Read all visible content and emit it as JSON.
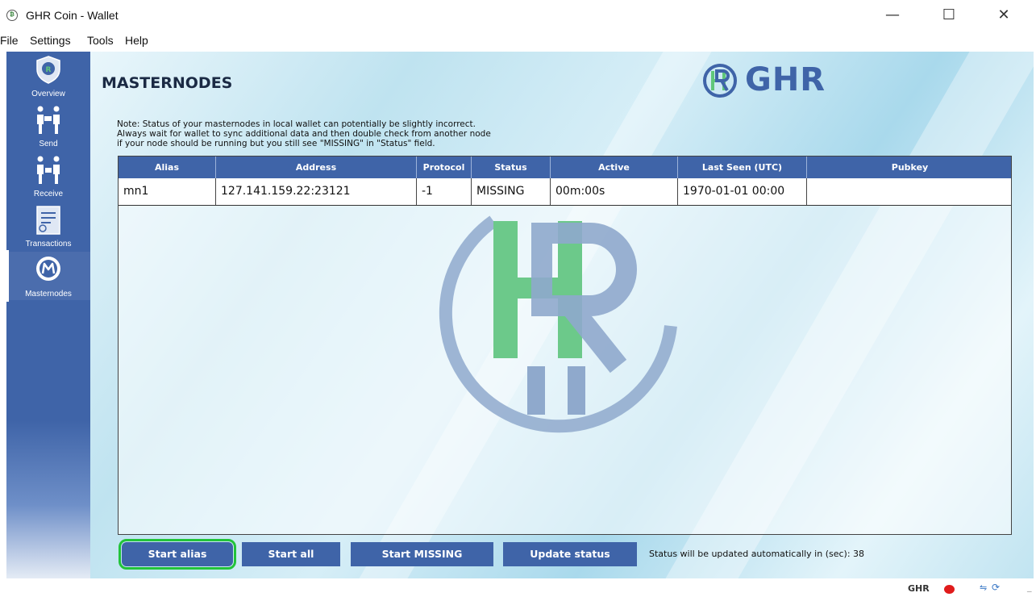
{
  "window": {
    "title": "GHR Coin - Wallet",
    "app_icon": "ghr-coin-icon",
    "minimize_glyph": "—",
    "maximize_glyph": "☐",
    "close_glyph": "✕"
  },
  "menu": [
    "File",
    "Settings",
    "Tools",
    "Help"
  ],
  "sidebar": {
    "items": [
      {
        "label": "Overview",
        "icon": "shield-icon"
      },
      {
        "label": "Send",
        "icon": "send-people-icon"
      },
      {
        "label": "Receive",
        "icon": "receive-people-icon"
      },
      {
        "label": "Transactions",
        "icon": "transactions-icon"
      },
      {
        "label": "Masternodes",
        "icon": "masternodes-icon",
        "active": true
      }
    ]
  },
  "page": {
    "title": "MASTERNODES",
    "brand": "GHR",
    "note_lines": [
      "Note: Status of your masternodes in local wallet can potentially be slightly incorrect.",
      "Always wait for wallet to sync additional data and then double check from another node",
      "if your node should be running but you still see \"MISSING\" in \"Status\" field."
    ]
  },
  "table": {
    "columns": [
      "Alias",
      "Address",
      "Protocol",
      "Status",
      "Active",
      "Last Seen (UTC)",
      "Pubkey"
    ],
    "rows": [
      [
        "mn1",
        "127.141.159.22:23121",
        "-1",
        "MISSING",
        "00m:00s",
        "1970-01-01 00:00",
        ""
      ]
    ]
  },
  "buttons": {
    "start_alias": "Start alias",
    "start_all": "Start all",
    "start_missing": "Start MISSING",
    "update_status": "Update status"
  },
  "auto_update": {
    "text": "Status will be updated automatically in (sec): 38",
    "seconds": 38
  },
  "statusbar": {
    "unit": "GHR",
    "connection": "disconnected",
    "network_glyph": "⇋",
    "sync_glyph": "⟳",
    "grip_glyph": "_"
  },
  "colors": {
    "accent": "#3f64a8",
    "brand_green": "#5fc77a",
    "focus_ring": "#22c33a",
    "status_dot": "#e01b1b"
  }
}
